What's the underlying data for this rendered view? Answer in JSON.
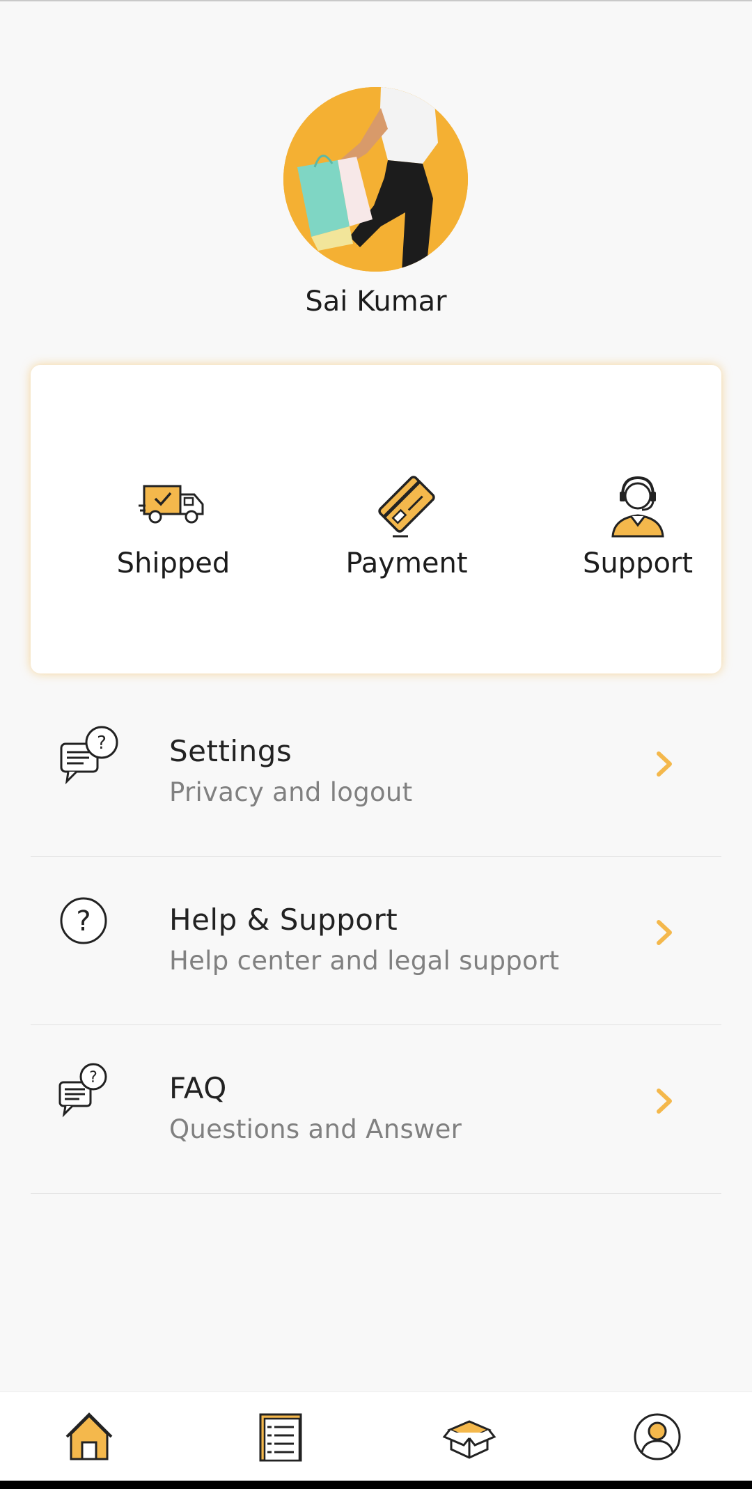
{
  "profile": {
    "name": "Sai Kumar",
    "avatar": "profile-photo"
  },
  "quick_actions": [
    {
      "label": "Shipped",
      "icon": "truck-icon"
    },
    {
      "label": "Payment",
      "icon": "credit-card-icon"
    },
    {
      "label": "Support",
      "icon": "headset-agent-icon"
    }
  ],
  "menu": [
    {
      "title": "Settings",
      "subtitle": "Privacy and logout",
      "icon": "chat-question-icon"
    },
    {
      "title": "Help & Support",
      "subtitle": "Help center and legal support",
      "icon": "question-circle-icon"
    },
    {
      "title": "FAQ",
      "subtitle": "Questions and Answer",
      "icon": "faq-chat-icon"
    }
  ],
  "bottom_nav": [
    {
      "name": "home",
      "icon": "home-icon"
    },
    {
      "name": "orders",
      "icon": "orders-list-icon"
    },
    {
      "name": "products",
      "icon": "box-icon"
    },
    {
      "name": "profile",
      "icon": "user-circle-icon"
    }
  ],
  "colors": {
    "accent": "#f4b84c",
    "background": "#f8f8f8",
    "card": "#ffffff",
    "text_primary": "#1c1c1c",
    "text_secondary": "#808080"
  }
}
